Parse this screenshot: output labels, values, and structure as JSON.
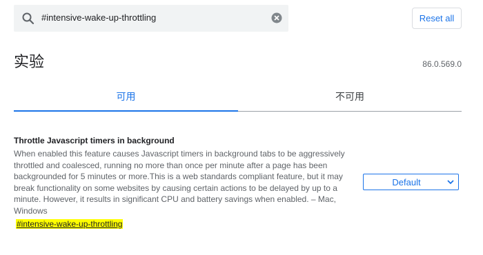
{
  "search": {
    "value": "#intensive-wake-up-throttling",
    "icon": "search-icon",
    "clear_icon": "clear-icon"
  },
  "header": {
    "reset_label": "Reset all",
    "title": "实验",
    "version": "86.0.569.0"
  },
  "tabs": [
    {
      "label": "可用",
      "active": true
    },
    {
      "label": "不可用",
      "active": false
    }
  ],
  "experiment": {
    "name": "Throttle Javascript timers in background",
    "description": "When enabled this feature causes Javascript timers in background tabs to be aggressively throttled and coalesced, running no more than once per minute after a page has been backgrounded for 5 minutes or more.This is a web standards compliant feature, but it may break functionality on some websites by causing certain actions to be delayed by up to a minute. However, it results in significant CPU and battery savings when enabled. – Mac, Windows",
    "tag": "#intensive-wake-up-throttling",
    "select_value": "Default"
  },
  "colors": {
    "accent": "#1a73e8",
    "highlight": "#ffff00"
  }
}
